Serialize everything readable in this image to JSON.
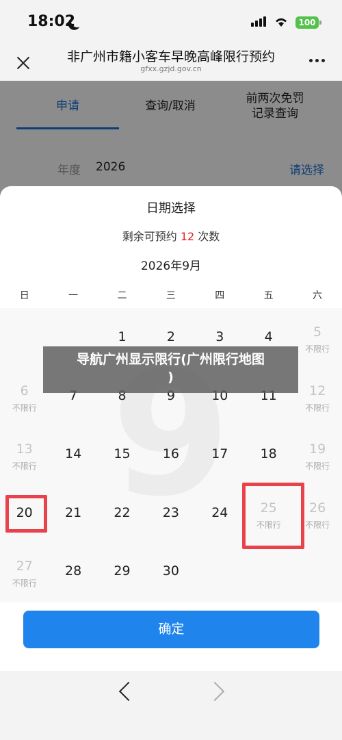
{
  "status_bar": {
    "time": "18:02",
    "battery": "100"
  },
  "nav": {
    "title": "非广州市籍小客车早晚高峰限行预约",
    "subtitle": "gfxx.gzjd.gov.cn"
  },
  "page": {
    "tabs": [
      {
        "label": "申请",
        "active": true
      },
      {
        "label": "查询/取消"
      },
      {
        "label": "前两次免罚\n记录查询"
      }
    ],
    "year_label": "年度",
    "year_value": "2026",
    "year_select": "请选择"
  },
  "sheet": {
    "title": "日期选择",
    "remaining_prefix": "剩余可预约",
    "remaining_count": "12",
    "remaining_suffix": "次数",
    "month": "2026年9月",
    "weekdays": [
      "日",
      "一",
      "二",
      "三",
      "四",
      "五",
      "六"
    ],
    "watermark": "9",
    "days": [
      {
        "num": "1",
        "note": "",
        "disabled": false
      },
      {
        "num": "2",
        "note": "",
        "disabled": false
      },
      {
        "num": "3",
        "note": "",
        "disabled": false
      },
      {
        "num": "4",
        "note": "",
        "disabled": false
      },
      {
        "num": "5",
        "note": "不限行",
        "disabled": true
      },
      {
        "num": "6",
        "note": "不限行",
        "disabled": true
      },
      {
        "num": "7",
        "note": "",
        "disabled": false
      },
      {
        "num": "8",
        "note": "",
        "disabled": false
      },
      {
        "num": "9",
        "note": "",
        "disabled": false
      },
      {
        "num": "10",
        "note": "",
        "disabled": false
      },
      {
        "num": "11",
        "note": "",
        "disabled": false
      },
      {
        "num": "12",
        "note": "不限行",
        "disabled": true
      },
      {
        "num": "13",
        "note": "不限行",
        "disabled": true
      },
      {
        "num": "14",
        "note": "",
        "disabled": false
      },
      {
        "num": "15",
        "note": "",
        "disabled": false
      },
      {
        "num": "16",
        "note": "",
        "disabled": false
      },
      {
        "num": "17",
        "note": "",
        "disabled": false
      },
      {
        "num": "18",
        "note": "",
        "disabled": false
      },
      {
        "num": "19",
        "note": "不限行",
        "disabled": true
      },
      {
        "num": "20",
        "note": "",
        "disabled": false
      },
      {
        "num": "21",
        "note": "",
        "disabled": false
      },
      {
        "num": "22",
        "note": "",
        "disabled": false
      },
      {
        "num": "23",
        "note": "",
        "disabled": false
      },
      {
        "num": "24",
        "note": "",
        "disabled": false
      },
      {
        "num": "25",
        "note": "不限行",
        "disabled": true
      },
      {
        "num": "26",
        "note": "不限行",
        "disabled": true
      },
      {
        "num": "27",
        "note": "不限行",
        "disabled": true
      },
      {
        "num": "28",
        "note": "",
        "disabled": false
      },
      {
        "num": "29",
        "note": "",
        "disabled": false
      },
      {
        "num": "30",
        "note": "",
        "disabled": false
      }
    ],
    "first_weekday_index": 2,
    "highlighted_days": [
      "20",
      "25"
    ],
    "confirm": "确定"
  },
  "caption": "导航广州显示限行(广州限行地图\n)",
  "colors": {
    "accent": "#1a6fd6",
    "highlight": "#e8434d",
    "count": "#e02020"
  }
}
